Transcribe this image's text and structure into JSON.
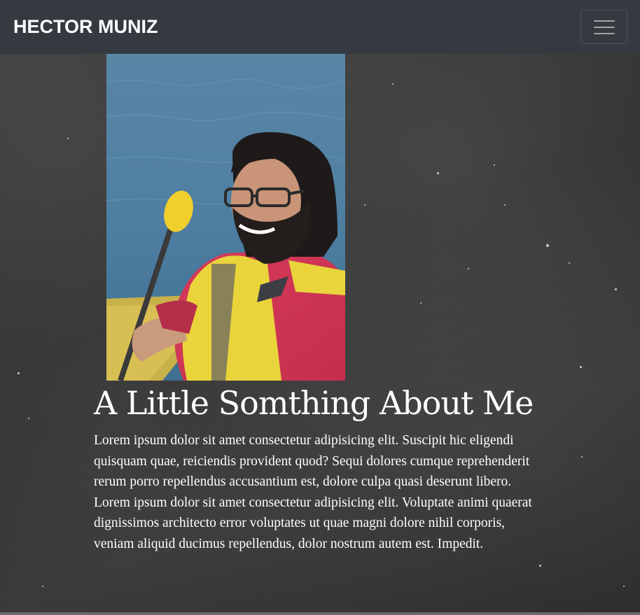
{
  "navbar": {
    "brand": "HECTOR MUNIZ",
    "toggler_icon": "hamburger-menu-icon"
  },
  "about": {
    "photo_alt": "Hector kayaking",
    "heading": "A Little Somthing About Me",
    "body": "Lorem ipsum dolor sit amet consectetur adipisicing elit. Suscipit hic eligendi quisquam quae, reiciendis provident quod? Sequi dolores cumque reprehenderit rerum porro repellendus accusantium est, dolore culpa quasi deserunt libero. Lorem ipsum dolor sit amet consectetur adipisicing elit. Voluptate animi quaerat dignissimos architecto error voluptates ut quae magni dolore nihil corporis, veniam aliquid ducimus repellendus, dolor nostrum autem est. Impedit."
  },
  "colors": {
    "navbar_bg": "#343a40",
    "text": "#ffffff"
  }
}
